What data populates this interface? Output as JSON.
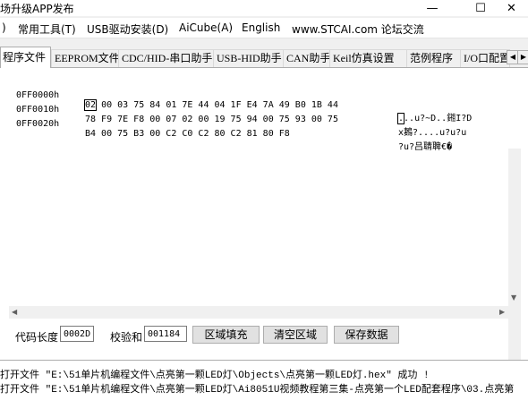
{
  "window": {
    "title": "场升级APP发布",
    "minimize_glyph": "—",
    "maximize_glyph": "☐",
    "close_glyph": "✕"
  },
  "menu": {
    "items": [
      {
        "label": ")"
      },
      {
        "label": "常用工具(T)"
      },
      {
        "label": "USB驱动安装(D)"
      },
      {
        "label": "AiCube(A)"
      },
      {
        "label": "English"
      },
      {
        "label": "www.STCAI.com 论坛交流"
      }
    ]
  },
  "tabs": [
    {
      "label": "程序文件",
      "active": true
    },
    {
      "label": "EEPROM文件"
    },
    {
      "label": "CDC/HID-串口助手"
    },
    {
      "label": "USB-HID助手"
    },
    {
      "label": "CAN助手"
    },
    {
      "label": "Keil仿真设置"
    },
    {
      "label": "范例程序"
    },
    {
      "label": "I/O口配置"
    }
  ],
  "tab_scroll": {
    "left": "◀",
    "right": "▶"
  },
  "hex_view": {
    "rows": [
      {
        "address": "0FF0000h",
        "first_byte": "02",
        "bytes": " 00 03 75 84 01 7E 44 04 1F E4 7A 49 B0 1B 44",
        "ascii_first": ".",
        "ascii": "..u?~D..鎺I?D"
      },
      {
        "address": "0FF0010h",
        "first_byte": "",
        "bytes": "78 F9 7E F8 00 07 02 00 19 75 94 00 75 93 00 75",
        "ascii_first": "",
        "ascii": "x鶈?....u?u?u"
      },
      {
        "address": "0FF0020h",
        "first_byte": "",
        "bytes": "B4 00 75 B3 00 C2 C0 C2 80 C2 81 80 F8",
        "ascii_first": "",
        "ascii": "?u?吕聙聛€�"
      }
    ]
  },
  "status": {
    "code_length_label": "代码长度",
    "code_length_value": "0002D",
    "checksum_label": "校验和",
    "checksum_value": "001184",
    "fill_button": "区域填充",
    "clear_button": "清空区域",
    "save_button": "保存数据"
  },
  "log": {
    "lines": [
      "打开文件 \"E:\\51单片机编程文件\\点亮第一颗LED灯\\Objects\\点亮第一颗LED灯.hex\" 成功 !",
      "打开文件 \"E:\\51单片机编程文件\\点亮第一颗LED灯\\Ai8051U视频教程第三集-点亮第一个LED配套程序\\03.点亮第"
    ]
  }
}
